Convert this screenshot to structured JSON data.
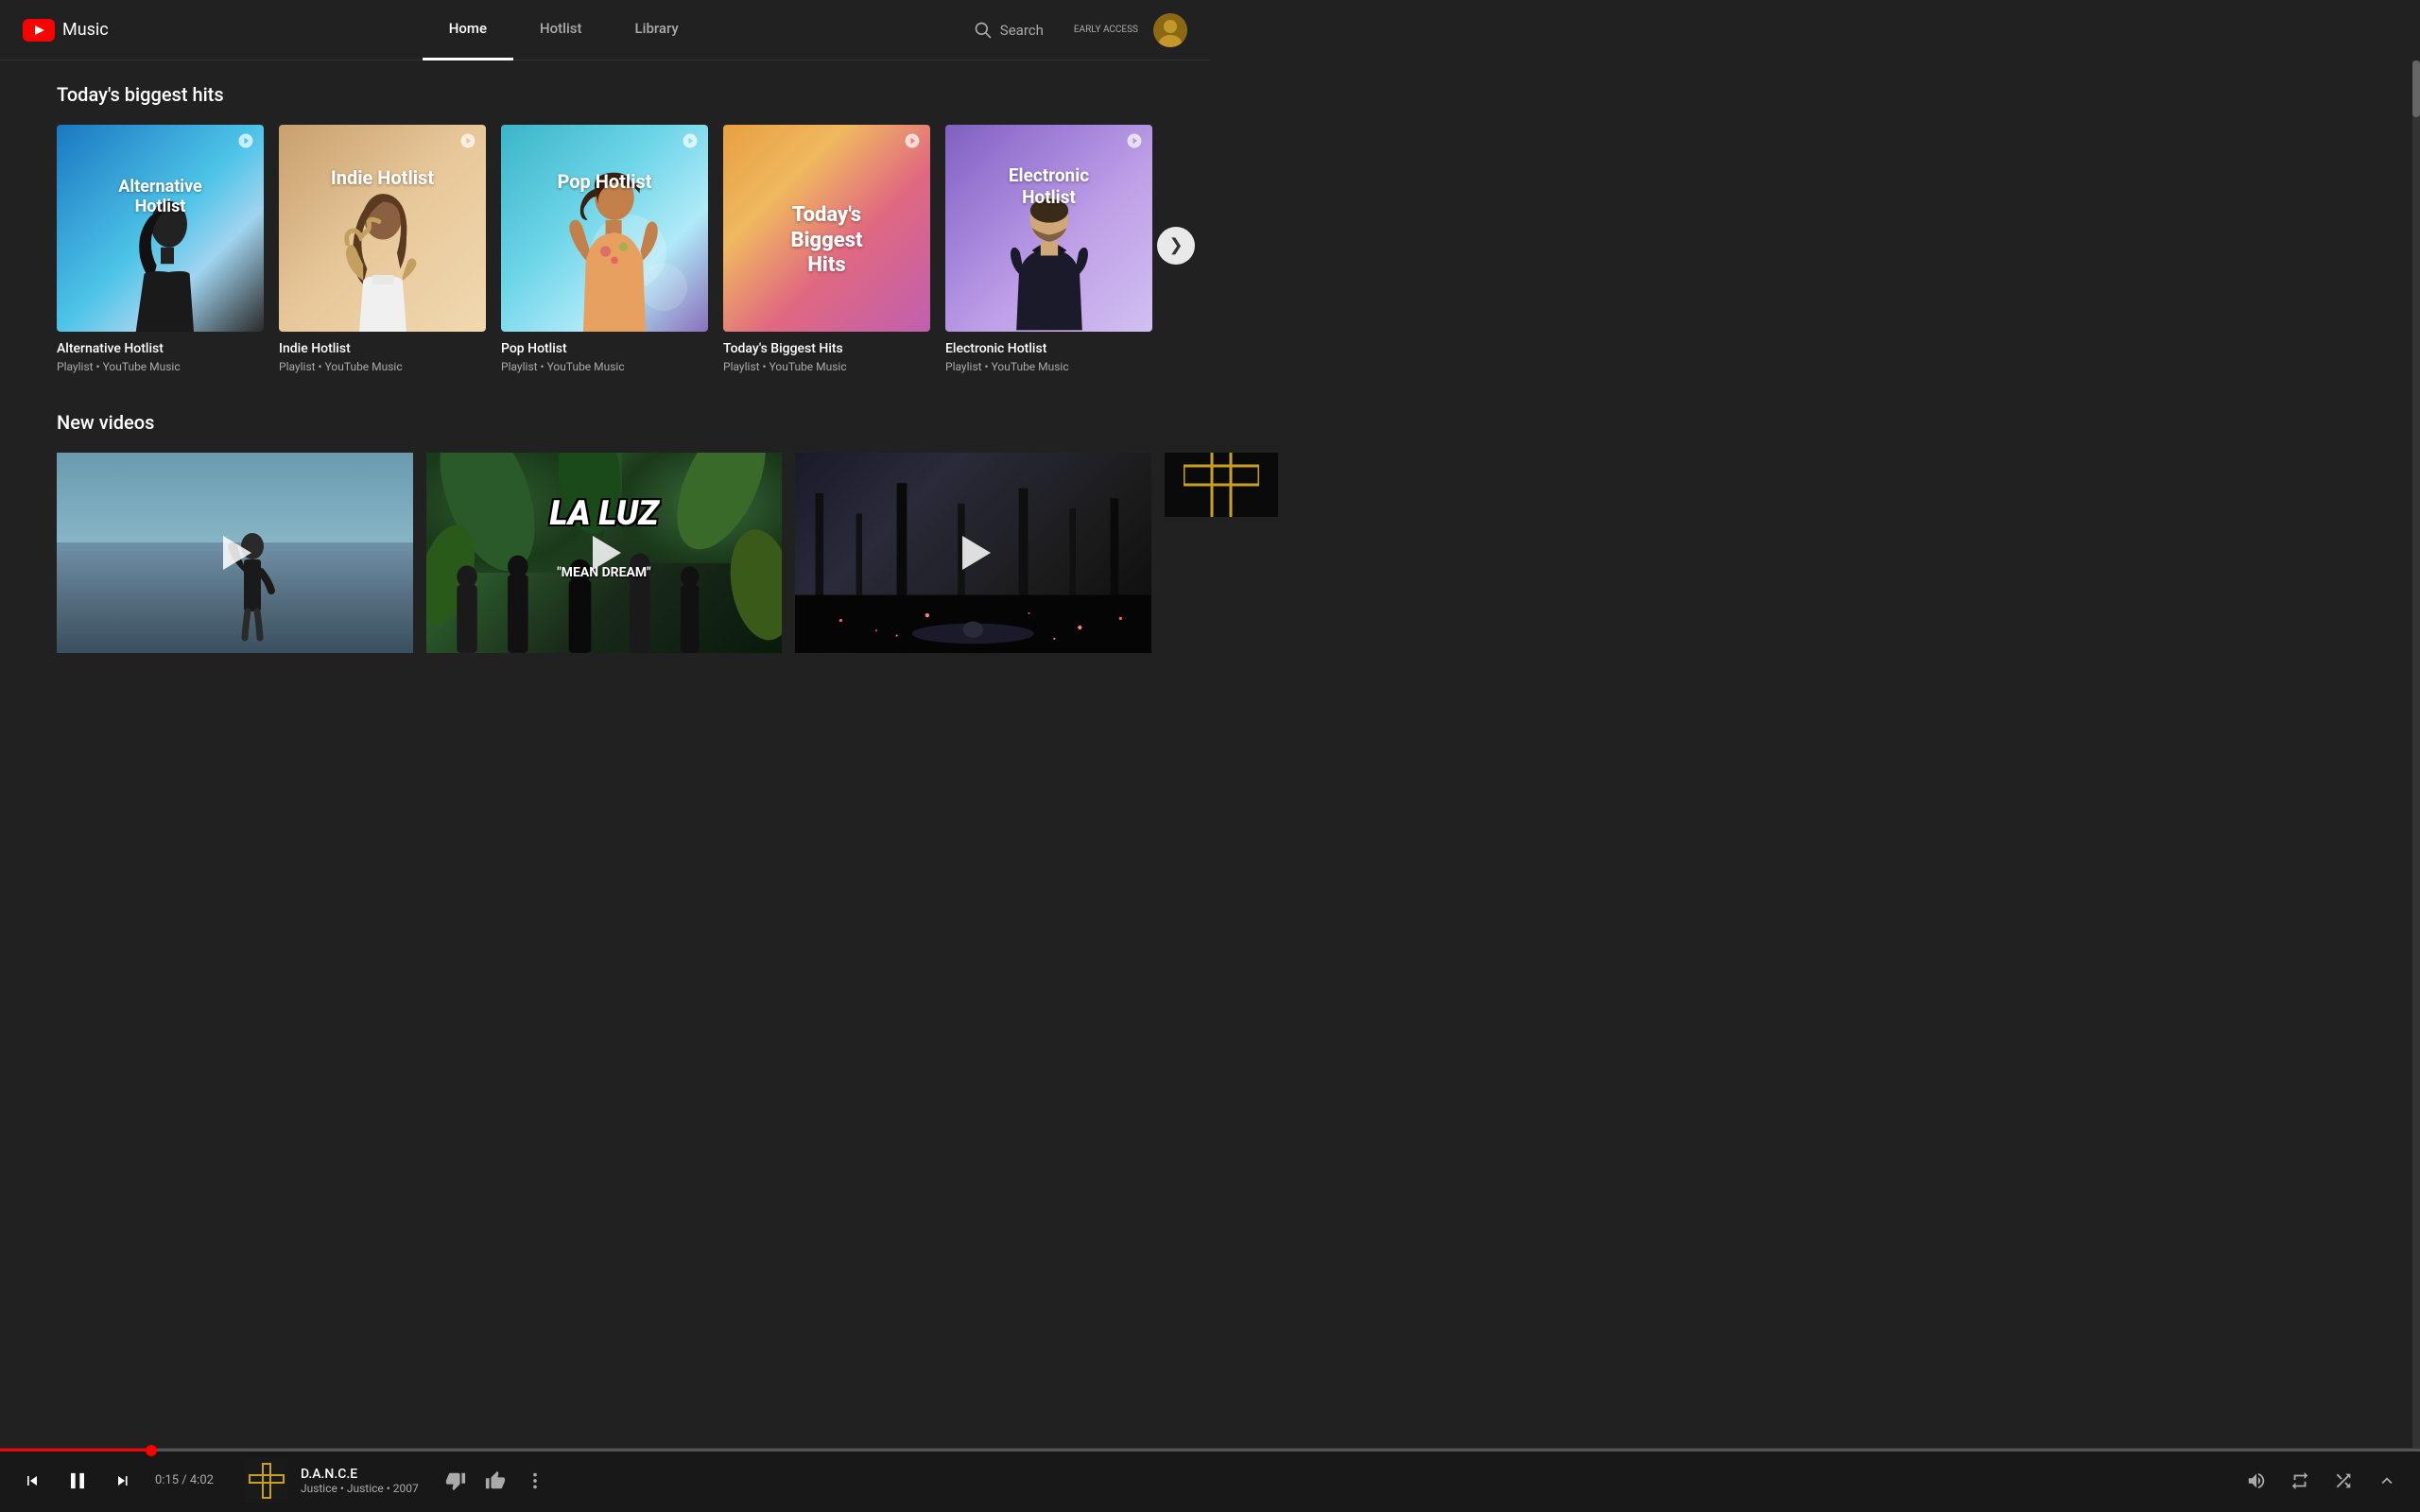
{
  "header": {
    "logo_text": "Music",
    "nav_items": [
      {
        "label": "Home",
        "active": true
      },
      {
        "label": "Hotlist",
        "active": false
      },
      {
        "label": "Library",
        "active": false
      }
    ],
    "search_label": "Search",
    "early_access_label": "EARLY ACCESS"
  },
  "sections": [
    {
      "id": "biggest-hits",
      "title": "Today's biggest hits",
      "cards": [
        {
          "id": "alt-hotlist",
          "label": "Alternative\nHotlist",
          "title": "Alternative Hotlist",
          "subtitle": "Playlist • YouTube Music",
          "theme": "alt"
        },
        {
          "id": "indie-hotlist",
          "label": "Indie Hotlist",
          "title": "Indie Hotlist",
          "subtitle": "Playlist • YouTube Music",
          "theme": "indie"
        },
        {
          "id": "pop-hotlist",
          "label": "Pop Hotlist",
          "title": "Pop Hotlist",
          "subtitle": "Playlist • YouTube Music",
          "theme": "pop"
        },
        {
          "id": "today-biggest",
          "label": "Today's Biggest\nHits",
          "title": "Today's Biggest Hits",
          "subtitle": "Playlist • YouTube Music",
          "theme": "biggest"
        },
        {
          "id": "electronic-hotlist",
          "label": "Electronic\nHotlist",
          "title": "Electronic Hotlist",
          "subtitle": "Playlist • YouTube Music",
          "theme": "electronic"
        }
      ]
    },
    {
      "id": "new-videos",
      "title": "New videos",
      "videos": [
        {
          "id": "video-1",
          "theme": "beach",
          "title": "",
          "subtitle": ""
        },
        {
          "id": "video-2",
          "theme": "la-luz",
          "band_name": "LA LUZ",
          "album_name": "\"MEAN DREAM\"",
          "title": "",
          "subtitle": ""
        },
        {
          "id": "video-3",
          "theme": "dark",
          "title": "",
          "subtitle": ""
        },
        {
          "id": "video-4",
          "theme": "cross",
          "title": "",
          "subtitle": ""
        }
      ]
    }
  ],
  "player": {
    "progress_percent": 6.25,
    "current_time": "0:15",
    "total_time": "4:02",
    "time_display": "0:15 / 4:02",
    "track_title": "D.A.N.C.E",
    "track_artist": "Justice • Justice • 2007",
    "skip_prev_label": "⏮",
    "pause_label": "⏸",
    "skip_next_label": "⏭"
  },
  "icons": {
    "play": "▶",
    "pause": "⏸",
    "skip_prev": "⏮",
    "skip_next": "⏭",
    "volume": "🔊",
    "repeat": "↻",
    "shuffle": "⇌",
    "thumbs_up": "👍",
    "thumbs_down": "👎",
    "more": "⋮",
    "chevron_right": "❯",
    "search": "🔍",
    "expand": "⌃"
  }
}
